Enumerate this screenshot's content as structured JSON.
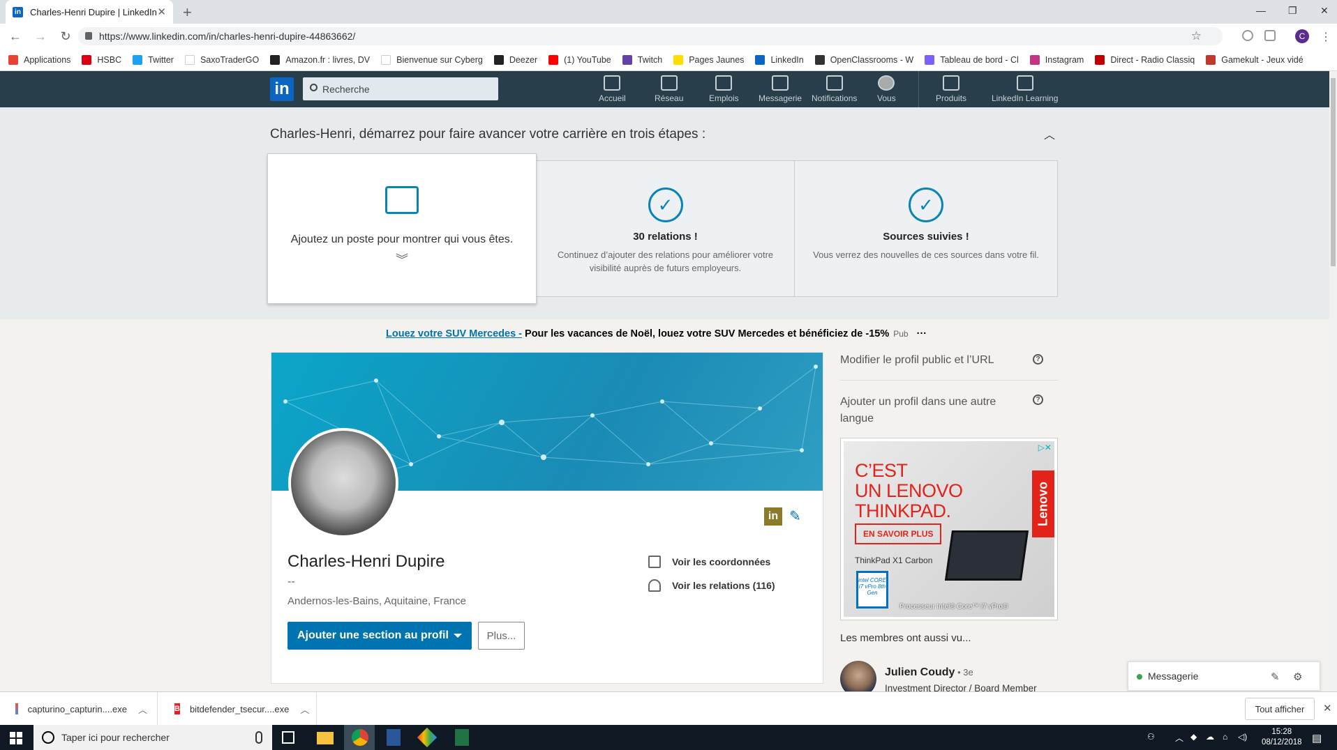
{
  "browser": {
    "tab_title": "Charles-Henri Dupire | LinkedIn",
    "tab_favicon": "in",
    "url": "https://www.linkedin.com/in/charles-henri-dupire-44863662/",
    "profile_initial": "C",
    "bookmarks": [
      {
        "label": "Applications",
        "color": "#e94235"
      },
      {
        "label": "HSBC",
        "color": "#db0011"
      },
      {
        "label": "Twitter",
        "color": "#1da1f2"
      },
      {
        "label": "SaxoTraderGO",
        "color": "#ffffff"
      },
      {
        "label": "Amazon.fr : livres, DV",
        "color": "#222222"
      },
      {
        "label": "Bienvenue sur Cyberg",
        "color": "#ffffff"
      },
      {
        "label": "Deezer",
        "color": "#222222"
      },
      {
        "label": "(1) YouTube",
        "color": "#ff0000"
      },
      {
        "label": "Twitch",
        "color": "#6441a5"
      },
      {
        "label": "Pages Jaunes",
        "color": "#ffdd00"
      },
      {
        "label": "LinkedIn",
        "color": "#0a66c2"
      },
      {
        "label": "OpenClassrooms - W",
        "color": "#333333"
      },
      {
        "label": "Tableau de bord - Cl",
        "color": "#7b61ff"
      },
      {
        "label": "Instagram",
        "color": "#c13584"
      },
      {
        "label": "Direct - Radio Classiq",
        "color": "#c00000"
      },
      {
        "label": "Gamekult - Jeux vidé",
        "color": "#c0392b"
      }
    ]
  },
  "linkedin": {
    "logo": "in",
    "search_placeholder": "Recherche",
    "nav": {
      "accueil": "Accueil",
      "reseau": "Réseau",
      "emplois": "Emplois",
      "messagerie": "Messagerie",
      "notifications": "Notifications",
      "vous": "Vous",
      "produits": "Produits",
      "learning": "LinkedIn Learning"
    }
  },
  "onboarding": {
    "title": "Charles-Henri, démarrez pour faire avancer votre carrière en trois étapes :",
    "card1_text": "Ajoutez un poste pour montrer qui vous êtes.",
    "card2_title": "30 relations !",
    "card2_desc": "Continuez d’ajouter des relations pour améliorer votre visibilité auprès de futurs employeurs.",
    "card3_title": "Sources suivies !",
    "card3_desc": "Vous verrez des nouvelles de ces sources dans votre fil."
  },
  "ad": {
    "link": "Louez votre SUV Mercedes -",
    "text": " Pour les vacances de Noël, louez votre SUV Mercedes et bénéficiez de -15%",
    "pub": "Pub",
    "more": "···"
  },
  "profile": {
    "name": "Charles-Henri Dupire",
    "headline": "--",
    "location": "Andernos-les-Bains, Aquitaine, France",
    "add_section": "Ajouter une section au profil",
    "more": "Plus...",
    "contact": "Voir les coordonnées",
    "relations": "Voir les relations (116)"
  },
  "rail": {
    "public_profile": "Modifier le profil public et l’URL",
    "other_language": "Ajouter un profil dans une autre langue",
    "help_glyph": "?",
    "also_viewed": "Les membres ont aussi vu...",
    "member_name": "Julien Coudy",
    "member_degree": " • 3e",
    "member_role": "Investment Director / Board Member"
  },
  "lenovo_ad": {
    "headline_1": "C’EST",
    "headline_2": "UN LENOVO",
    "headline_3": "THINKPAD.",
    "button": "EN SAVOIR PLUS",
    "product": "ThinkPad X1 Carbon",
    "brand": "Lenovo",
    "intel": "intel CORE i7 vPro 8th Gen",
    "footer": "Processeur Intel® Core™ i7 vPro®",
    "adchoices": "▷✕"
  },
  "messaging": {
    "label": "Messagerie"
  },
  "downloads": {
    "file1": "capturino_capturin....exe",
    "file2": "bitdefender_tsecur....exe",
    "show_all": "Tout afficher"
  },
  "taskbar": {
    "search_placeholder": "Taper ici pour rechercher",
    "time": "15:28",
    "date": "08/12/2018"
  }
}
